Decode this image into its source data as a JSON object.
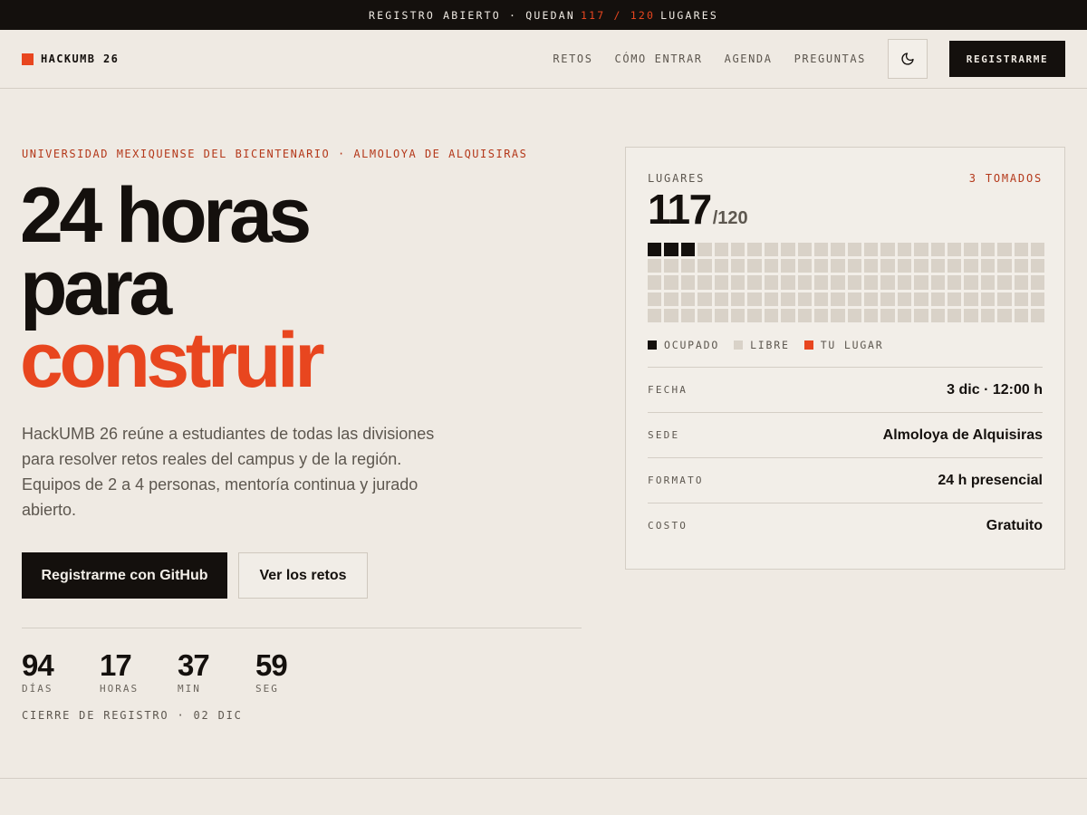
{
  "topbar": {
    "prefix": "REGISTRO ABIERTO · QUEDAN",
    "seats": "117 / 120",
    "suffix": "LUGARES"
  },
  "header": {
    "logo": "HACKUMB 26",
    "nav": [
      "RETOS",
      "CÓMO ENTRAR",
      "AGENDA",
      "PREGUNTAS"
    ],
    "theme_icon": "moon-icon",
    "cta": "REGISTRARME"
  },
  "hero": {
    "eyebrow": "UNIVERSIDAD MEXIQUENSE DEL BICENTENARIO · ALMOLOYA DE ALQUISIRAS",
    "title_line1": "24 horas",
    "title_line2": "para",
    "title_line3": "construir",
    "description": "HackUMB 26 reúne a estudiantes de todas las divisiones para resolver retos reales del campus y de la región. Equipos de 2 a 4 personas, mentoría continua y jurado abierto.",
    "primary_button": "Registrarme con GitHub",
    "secondary_button": "Ver los retos"
  },
  "countdown": {
    "items": [
      {
        "value": "94",
        "label": "DÍAS"
      },
      {
        "value": "17",
        "label": "HORAS"
      },
      {
        "value": "37",
        "label": "MIN"
      },
      {
        "value": "59",
        "label": "SEG"
      }
    ],
    "note": "CIERRE DE REGISTRO · 02 DIC"
  },
  "card": {
    "label": "LUGARES",
    "taken_label": "3 TOMADOS",
    "available": "117",
    "total": "/120",
    "seats_total": 120,
    "seats_taken": 3,
    "seats_mine": 0,
    "legend": {
      "taken": "OCUPADO",
      "free": "LIBRE",
      "mine": "TU LUGAR"
    },
    "details": [
      {
        "key": "FECHA",
        "value": "3 dic · 12:00 h"
      },
      {
        "key": "SEDE",
        "value": "Almoloya de Alquisiras"
      },
      {
        "key": "FORMATO",
        "value": "24 h presencial"
      },
      {
        "key": "COSTO",
        "value": "Gratuito"
      }
    ]
  },
  "colors": {
    "accent": "#e8461f",
    "dark": "#14100d",
    "background": "#efeae3"
  }
}
